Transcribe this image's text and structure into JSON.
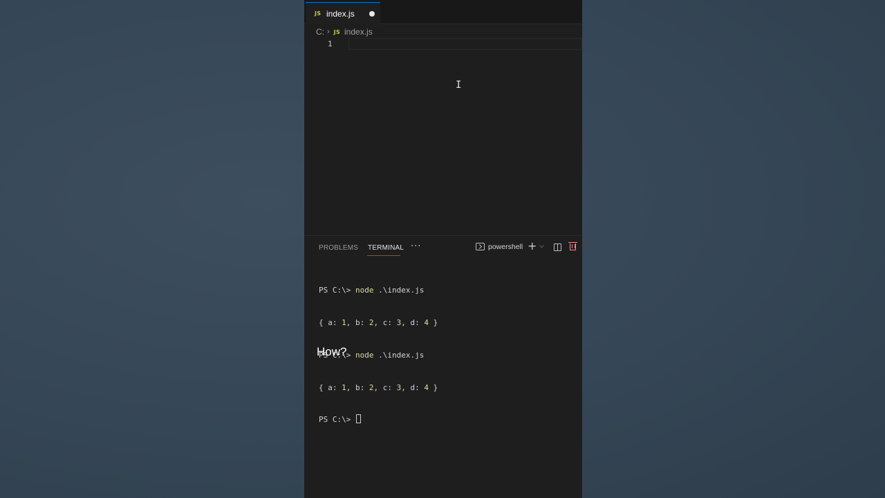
{
  "editor": {
    "tab": {
      "icon": "JS",
      "filename": "index.js",
      "dirty": true
    },
    "breadcrumb": {
      "drive": "C:",
      "icon": "JS",
      "filename": "index.js"
    },
    "line_numbers": [
      "1"
    ]
  },
  "panel": {
    "tabs": [
      {
        "label": "PROBLEMS",
        "active": false
      },
      {
        "label": "TERMINAL",
        "active": true
      }
    ],
    "more": "···",
    "shell_name": "powershell"
  },
  "terminal": {
    "prompt": "PS C:\\>",
    "lines": [
      {
        "kind": "cmd",
        "command": "node",
        "args": ".\\index.js"
      },
      {
        "kind": "out",
        "text": "{ a: 1, b: 2, c: 3, d: 4 }"
      },
      {
        "kind": "cmd",
        "command": "node",
        "args": ".\\index.js"
      },
      {
        "kind": "out",
        "text": "{ a: 1, b: 2, c: 3, d: 4 }"
      },
      {
        "kind": "prompt"
      }
    ]
  },
  "caption": "How?",
  "colors": {
    "background": "#3a4b5b",
    "editor_bg": "#1e1e1e",
    "accent": "#0078d4",
    "js_icon": "#cbcb41",
    "command": "#dcdcaa",
    "trash": "#f08b8b"
  }
}
